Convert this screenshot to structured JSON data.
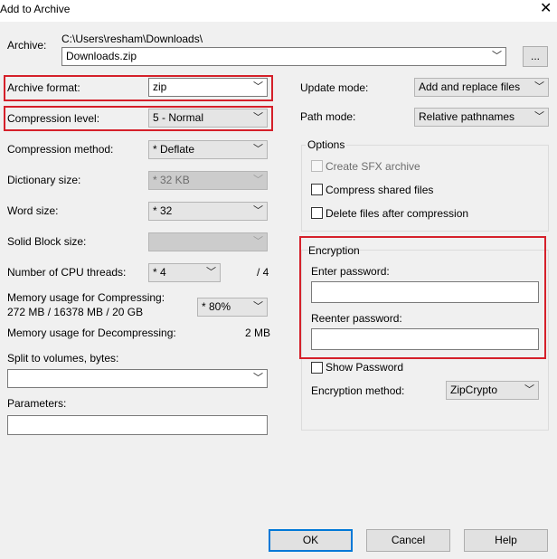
{
  "window": {
    "title": "Add to Archive",
    "close_glyph": "✕"
  },
  "archive": {
    "label": "Archive:",
    "path": "C:\\Users\\resham\\Downloads\\",
    "value": "Downloads.zip",
    "browse_label": "..."
  },
  "left": {
    "archive_format": {
      "label": "Archive format:",
      "value": "zip"
    },
    "compression_level": {
      "label": "Compression level:",
      "value": "5 - Normal"
    },
    "compression_method": {
      "label": "Compression method:",
      "value": "* Deflate"
    },
    "dictionary_size": {
      "label": "Dictionary size:",
      "value": "* 32 KB"
    },
    "word_size": {
      "label": "Word size:",
      "value": "* 32"
    },
    "solid_block_size": {
      "label": "Solid Block size:",
      "value": ""
    },
    "cpu_threads": {
      "label": "Number of CPU threads:",
      "value": "* 4",
      "max": "/ 4"
    },
    "memory_compress": {
      "label": "Memory usage for Compressing:",
      "detail": "272 MB / 16378 MB / 20 GB",
      "value": "* 80%"
    },
    "memory_decompress": {
      "label": "Memory usage for Decompressing:",
      "value": "2 MB"
    },
    "split": {
      "label": "Split to volumes, bytes:",
      "value": ""
    },
    "parameters": {
      "label": "Parameters:",
      "value": ""
    }
  },
  "right": {
    "update_mode": {
      "label": "Update mode:",
      "value": "Add and replace files"
    },
    "path_mode": {
      "label": "Path mode:",
      "value": "Relative pathnames"
    },
    "options": {
      "title": "Options",
      "create_sfx": "Create SFX archive",
      "compress_shared": "Compress shared files",
      "delete_after": "Delete files after compression"
    },
    "encryption": {
      "title": "Encryption",
      "enter_password": "Enter password:",
      "reenter_password": "Reenter password:",
      "show_password": "Show Password",
      "method_label": "Encryption method:",
      "method_value": "ZipCrypto"
    }
  },
  "buttons": {
    "ok": "OK",
    "cancel": "Cancel",
    "help": "Help"
  },
  "colors": {
    "highlight": "#d5202a",
    "default_button": "#0078d7",
    "dialog_bg": "#f0f0f0"
  }
}
